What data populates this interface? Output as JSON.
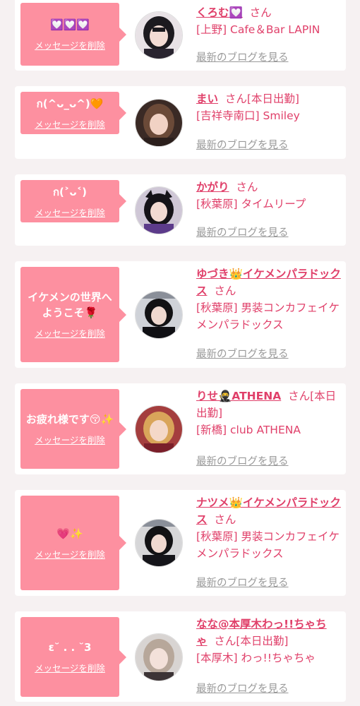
{
  "colors": {
    "accent": "#e0406a",
    "bubble": "#fd90a0",
    "background": "#f6f1f2",
    "muted": "#9a9a9a"
  },
  "entries": [
    {
      "message": "💟💟💟",
      "delete_label": "メッセージを削除",
      "name": "くろむ💟",
      "suffix": "さん",
      "shop": "[上野] Cafe＆Bar LAPIN",
      "blog_label": "最新のブログを見る",
      "avatar": "avatar-girl-black-hair"
    },
    {
      "message": "ก(^ᴗ_ᴗ^)🧡",
      "delete_label": "メッセージを削除",
      "name": "まい",
      "suffix": "さん[本日出勤]",
      "shop": "[吉祥寺南口] Smiley",
      "blog_label": "最新のブログを見る",
      "avatar": "avatar-girl-brown-hair"
    },
    {
      "message": "ก(˃ᴗ˂)",
      "delete_label": "メッセージを削除",
      "name": "かがり",
      "suffix": "さん",
      "shop": "[秋葉原] タイムリープ",
      "blog_label": "最新のブログを見る",
      "avatar": "avatar-girl-cat-ears"
    },
    {
      "message": "イケメンの世界へようこそ🌹",
      "delete_label": "メッセージを削除",
      "name": "ゆづき👑イケメンパラドックス",
      "suffix": "さん",
      "shop": "[秋葉原] 男装コンカフェイケメンパラドックス",
      "blog_label": "最新のブログを見る",
      "avatar": "avatar-ikemen-1"
    },
    {
      "message": "お疲れ様です😚✨",
      "delete_label": "メッセージを削除",
      "name": "りせ🥷ATHENA",
      "suffix": "さん[本日出勤]",
      "shop": "[新橋] club ATHENA",
      "blog_label": "最新のブログを見る",
      "avatar": "avatar-girl-blonde"
    },
    {
      "message": "💗✨",
      "delete_label": "メッセージを削除",
      "name": "ナツメ👑イケメンパラドックス",
      "suffix": "さん",
      "shop": "[秋葉原] 男装コンカフェイケメンパラドックス",
      "blog_label": "最新のブログを見る",
      "avatar": "avatar-ikemen-2"
    },
    {
      "message": "ε˘ . . ˘3",
      "delete_label": "メッセージを削除",
      "name": "なな@本厚木わっ!!ちゃちゃ",
      "suffix": "さん[本日出勤]",
      "shop": "[本厚木] わっ!!ちゃちゃ",
      "blog_label": "最新のブログを見る",
      "avatar": "avatar-girl-light-hair"
    }
  ]
}
